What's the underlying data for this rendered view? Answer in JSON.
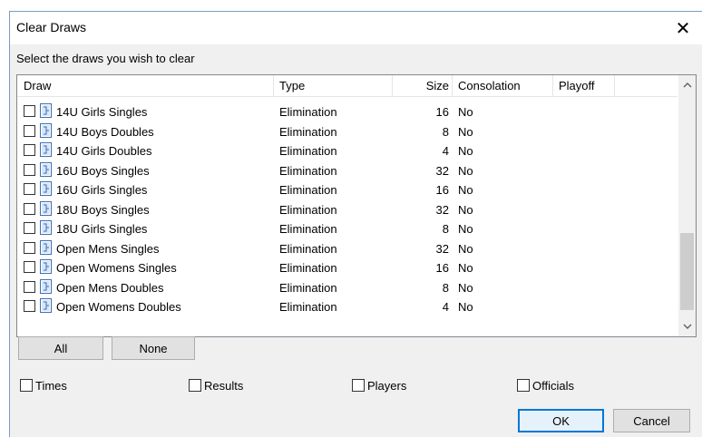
{
  "window": {
    "title": "Clear Draws",
    "close_icon": "✕"
  },
  "prompt": "Select the draws you wish to clear",
  "columns": [
    "Draw",
    "Type",
    "Size",
    "Consolation",
    "Playoff"
  ],
  "draws": [
    {
      "name": "14U Girls Singles",
      "type": "Elimination",
      "size": "16",
      "consolation": "No",
      "playoff": ""
    },
    {
      "name": "14U Boys Doubles",
      "type": "Elimination",
      "size": "8",
      "consolation": "No",
      "playoff": ""
    },
    {
      "name": "14U Girls Doubles",
      "type": "Elimination",
      "size": "4",
      "consolation": "No",
      "playoff": ""
    },
    {
      "name": "16U Boys Singles",
      "type": "Elimination",
      "size": "32",
      "consolation": "No",
      "playoff": ""
    },
    {
      "name": "16U Girls Singles",
      "type": "Elimination",
      "size": "16",
      "consolation": "No",
      "playoff": ""
    },
    {
      "name": "18U Boys Singles",
      "type": "Elimination",
      "size": "32",
      "consolation": "No",
      "playoff": ""
    },
    {
      "name": "18U Girls Singles",
      "type": "Elimination",
      "size": "8",
      "consolation": "No",
      "playoff": ""
    },
    {
      "name": "Open Mens Singles",
      "type": "Elimination",
      "size": "32",
      "consolation": "No",
      "playoff": ""
    },
    {
      "name": "Open Womens Singles",
      "type": "Elimination",
      "size": "16",
      "consolation": "No",
      "playoff": ""
    },
    {
      "name": "Open Mens Doubles",
      "type": "Elimination",
      "size": "8",
      "consolation": "No",
      "playoff": ""
    },
    {
      "name": "Open Womens Doubles",
      "type": "Elimination",
      "size": "4",
      "consolation": "No",
      "playoff": ""
    }
  ],
  "select_buttons": {
    "all": "All",
    "none": "None"
  },
  "options": {
    "times": "Times",
    "results": "Results",
    "players": "Players",
    "officials": "Officials"
  },
  "footer": {
    "ok": "OK",
    "cancel": "Cancel"
  },
  "icons": {
    "draw_row": "draw-document-icon",
    "scroll_up": "chevron-up-icon",
    "scroll_down": "chevron-down-icon"
  },
  "colors": {
    "accent": "#0078d7",
    "window_bg": "#f0f0f0",
    "list_bg": "#ffffff"
  }
}
